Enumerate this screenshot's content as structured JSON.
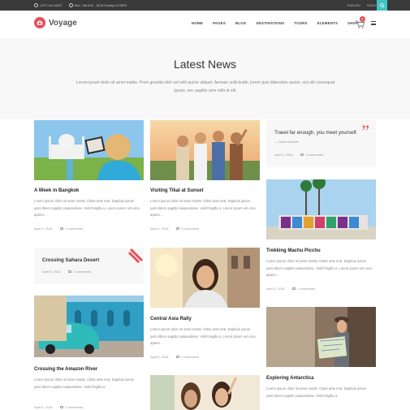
{
  "topbar": {
    "phone": "1-677-124-44227",
    "hours": "Mon - Sat 8.00 - 18.00 Sunday CLOSED",
    "language": "ENGLISH",
    "signin": "SIGN IN"
  },
  "brand": {
    "name": "Voyage"
  },
  "nav": {
    "items": [
      "HOME",
      "PAGES",
      "BLOG",
      "DESTINATIONS",
      "TOURS",
      "ELEMENTS",
      "SHOP"
    ],
    "cart_count": "0"
  },
  "header": {
    "title": "Latest News",
    "intro": "Lorem ipsum dolor sit amet mattis. Proin gravida nibh vel velit auctor aliquet. Aenean sollicitudin, lorem quis bibendum auctor, nisi elit consequat ipsum, nec sagittis sem nibh id elit."
  },
  "posts": {
    "bangkok": {
      "title": "A Week in Bangkok",
      "excerpt": "Lorem ipsum dolor sit amet mattis. Clāss ante erat. Dapibus ipsum justo libero sagittis suspendisse. Velit fringilla a. Lorem ipsum vel urna aptent...",
      "date": "April 5, 2016",
      "comments": "0 comments"
    },
    "tikal": {
      "title": "Visiting Tikal at Sunset",
      "excerpt": "Lorem ipsum dolor sit amet mattis. Clāss ante erat. Dapibus ipsum justo libero sagittis suspendisse. Velit fringilla a. Lorem ipsum vel urna aptent...",
      "date": "April 5, 2016",
      "comments": "0 comments"
    },
    "quote": {
      "title": "Travel far enough, you meet yourself.",
      "author": "— David Mitchell",
      "date": "April 5, 2016",
      "comments": "0 comments"
    },
    "machu": {
      "title": "Trekking Machu Picchu",
      "excerpt": "Lorem ipsum dolor sit amet mattis. Clāss ante erat. Dapibus ipsum justo libero sagittis suspendisse. Velit fringilla a. Lorem ipsum vel urna aptent...",
      "date": "April 5, 2016",
      "comments": "0 comments"
    },
    "sahara": {
      "title": "Crossing Sahara Desert",
      "date": "April 5, 2016",
      "comments": "4 comments"
    },
    "asia": {
      "title": "Central Asia Rally",
      "excerpt": "Lorem ipsum dolor sit amet mattis. Clāss ante erat. Dapibus ipsum justo libero sagittis suspendisse. Velit fringilla a. Lorem ipsum vel urna aptent...",
      "date": "April 5, 2016",
      "comments": "0 comments"
    },
    "amazon": {
      "title": "Crossing the Amazon River",
      "excerpt": "Lorem ipsum dolor sit amet mattis. Clāss ante erat. Dapibus ipsum justo libero sagittis suspendisse. Velit fringilla a.",
      "date": "April 5, 2016",
      "comments": "0 comments"
    },
    "antarctica": {
      "title": "Exploring Antarctica",
      "excerpt": "Lorem ipsum dolor sit amet mattis. Clāss ante erat. Dapibus ipsum justo libero sagittis suspendisse. Velit fringilla a.",
      "date": "April 5, 2016",
      "comments": "0 comments"
    }
  },
  "colors": {
    "accent": "#e6505a",
    "search_bg": "#40c4c8"
  }
}
